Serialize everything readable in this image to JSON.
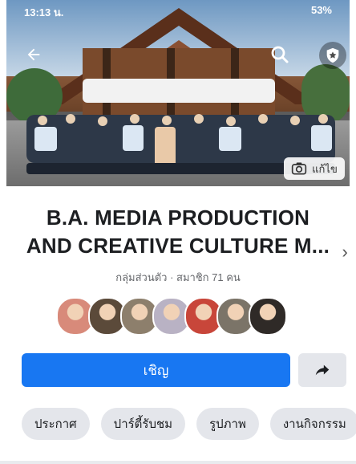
{
  "status_bar": {
    "left_text": "13:13 น.",
    "right_text": "53%"
  },
  "cover": {
    "photos_label": "แก้ไข"
  },
  "group": {
    "title_line1": "B.A. MEDIA PRODUCTION",
    "title_line2": "AND CREATIVE CULTURE M...",
    "meta": "กลุ่มส่วนตัว · สมาชิก 71 คน",
    "member_avatar_colors": [
      "#d88a7a",
      "#5b4a3a",
      "#8d7f6c",
      "#b9b2c4",
      "#c8463a",
      "#7b7468",
      "#2f2a27"
    ]
  },
  "actions": {
    "join_label": "เชิญ"
  },
  "chips": [
    "ประกาศ",
    "ปาร์ตี้รับชม",
    "รูปภาพ",
    "งานกิจกรรม"
  ],
  "colors": {
    "accent": "#1877f2"
  },
  "icons": [
    "back-arrow-icon",
    "search-icon",
    "admin-badge-icon",
    "camera-icon",
    "share-arrow-icon",
    "chevron-right-icon"
  ]
}
